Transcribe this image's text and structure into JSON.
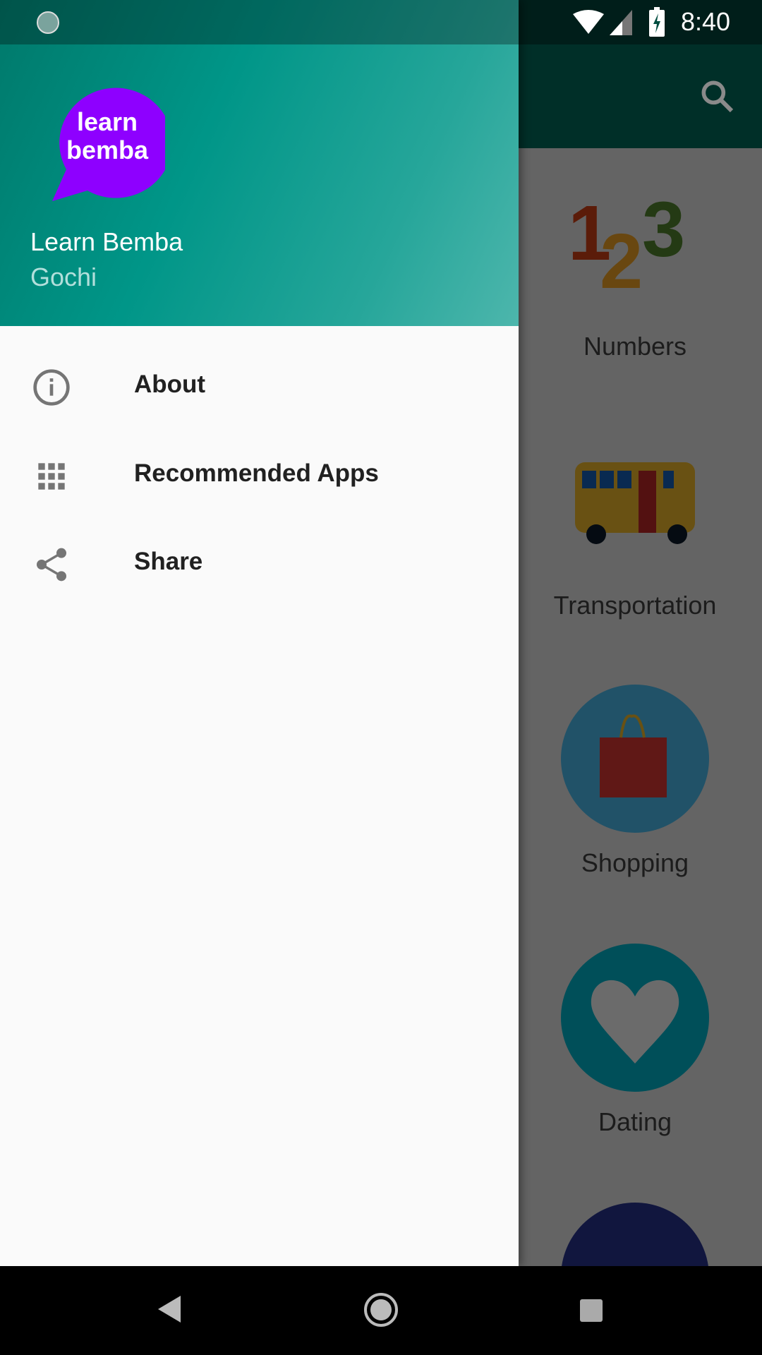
{
  "status_bar": {
    "time": "8:40"
  },
  "app_bar": {
    "search_icon": "search-icon"
  },
  "categories": [
    {
      "label": "Numbers",
      "icon": "numbers-123-icon"
    },
    {
      "label": "Transportation",
      "icon": "bus-icon"
    },
    {
      "label": "Shopping",
      "icon": "shopping-bag-icon"
    },
    {
      "label": "Dating",
      "icon": "heart-icon"
    }
  ],
  "drawer": {
    "logo_text": "learn bemba",
    "title": "Learn Bemba",
    "subtitle": "Gochi",
    "items": [
      {
        "label": "About",
        "icon": "info-icon"
      },
      {
        "label": "Recommended Apps",
        "icon": "apps-grid-icon"
      },
      {
        "label": "Share",
        "icon": "share-icon"
      }
    ]
  },
  "colors": {
    "header": "#009688",
    "logo": "#8e00ff",
    "appbar": "#004d40"
  }
}
